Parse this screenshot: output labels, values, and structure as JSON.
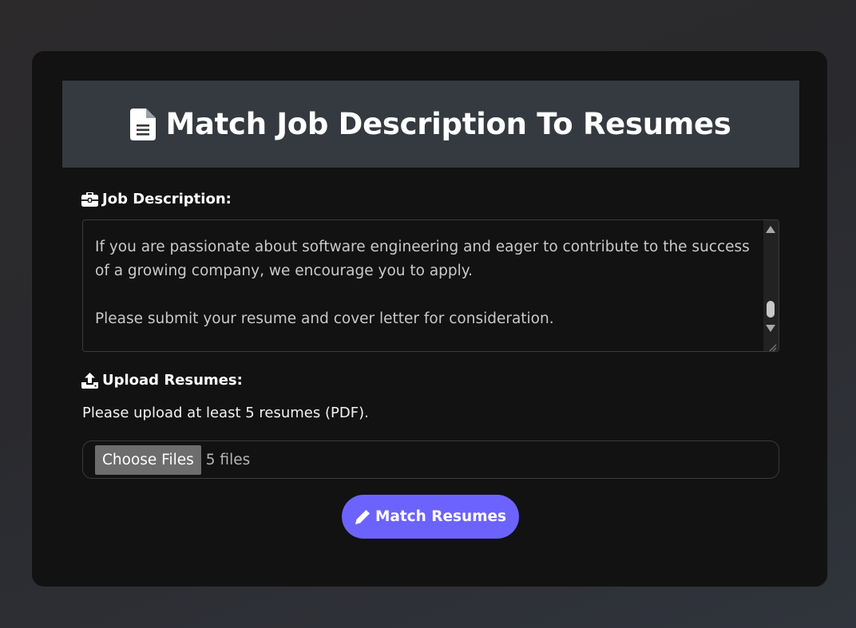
{
  "header": {
    "icon": "file-lines-icon",
    "title": "Match Job Description To Resumes"
  },
  "job_description": {
    "icon": "briefcase-icon",
    "label": "Job Description:",
    "paragraph_1": "If you are passionate about software engineering and eager to contribute to the success of a growing company, we encourage you to apply.",
    "paragraph_2": "Please submit your resume and cover letter for consideration."
  },
  "upload": {
    "icon": "upload-icon",
    "label": "Upload Resumes:",
    "help_text": "Please upload at least 5 resumes (PDF).",
    "choose_button": "Choose Files",
    "file_count": "5 files"
  },
  "submit": {
    "icon": "pencil-icon",
    "label": "Match Resumes"
  },
  "colors": {
    "card_background": "#121212",
    "header_background": "#343a40",
    "accent": "#6c63ff"
  }
}
